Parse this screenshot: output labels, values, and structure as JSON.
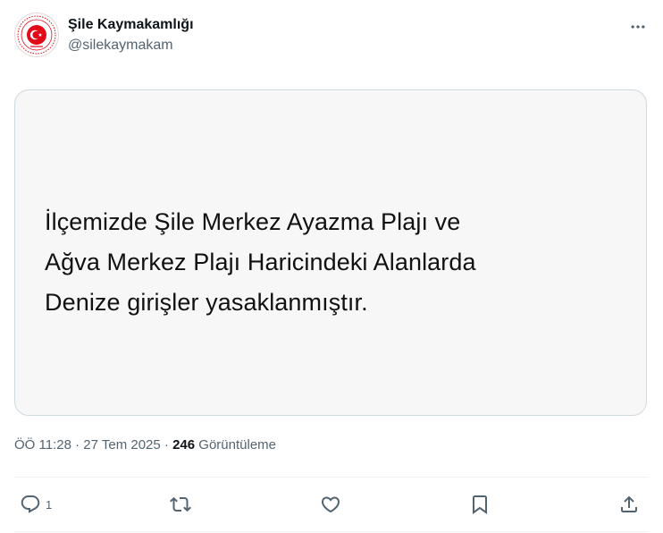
{
  "author": {
    "display_name": "Şile Kaymakamlığı",
    "handle": "@silekaymakam",
    "avatar_icon": "seal-icon",
    "brand_color": "#e30a17"
  },
  "post": {
    "text_lines": [
      "İlçemizde Şile Merkez Ayazma Plajı ve",
      "Ağva Merkez Plajı Haricindeki Alanlarda",
      "Denize girişler yasaklanmıştır."
    ]
  },
  "meta": {
    "time": "ÖÖ 11:28",
    "sep1": "·",
    "date": "27 Tem 2025",
    "sep2": "·",
    "views": "246",
    "views_label": "Görüntüleme"
  },
  "actions": {
    "reply_count": "1",
    "icons": [
      "reply-icon",
      "repost-icon",
      "like-icon",
      "bookmark-icon",
      "share-icon"
    ],
    "icon_color": "#536471"
  }
}
